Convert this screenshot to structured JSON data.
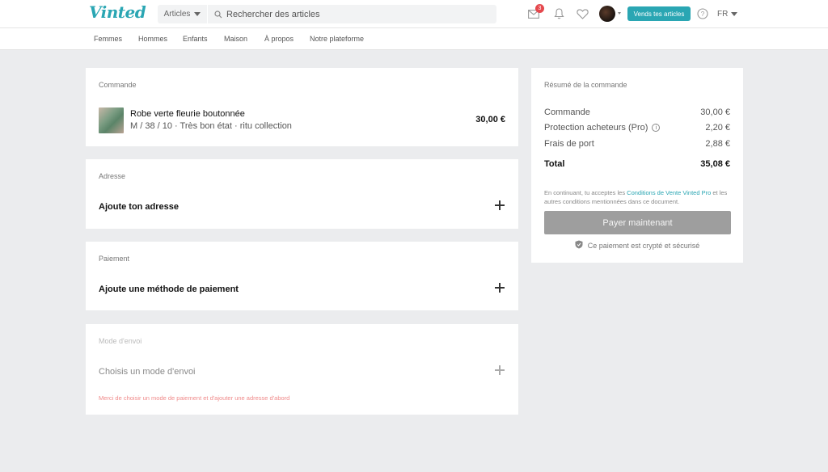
{
  "header": {
    "logo": "Vinted",
    "search_category": "Articles",
    "search_placeholder": "Rechercher des articles",
    "inbox_count": "3",
    "sell_label": "Vends tes articles",
    "language": "FR"
  },
  "nav": [
    "Femmes",
    "Hommes",
    "Enfants",
    "Maison",
    "À propos",
    "Notre plateforme"
  ],
  "order": {
    "title": "Commande",
    "item_name": "Robe verte fleurie boutonnée",
    "item_details": "M / 38 / 10 · Très bon état · ritu collection",
    "item_price": "30,00 €"
  },
  "address": {
    "title": "Adresse",
    "action": "Ajoute ton adresse"
  },
  "payment": {
    "title": "Paiement",
    "action": "Ajoute une méthode de paiement"
  },
  "shipping": {
    "title": "Mode d'envoi",
    "action": "Choisis un mode d'envoi",
    "error": "Merci de choisir un mode de paiement et d'ajouter une adresse d'abord"
  },
  "summary": {
    "title": "Résumé de la commande",
    "rows": [
      {
        "label": "Commande",
        "value": "30,00 €"
      },
      {
        "label": "Protection acheteurs (Pro)",
        "value": "2,20 €"
      },
      {
        "label": "Frais de port",
        "value": "2,88 €"
      }
    ],
    "total_label": "Total",
    "total_value": "35,08 €",
    "legal_prefix": "En continuant, tu acceptes les ",
    "legal_link": "Conditions de Vente Vinted Pro",
    "legal_suffix": " et les autres conditions mentionnées dans ce document.",
    "pay_label": "Payer maintenant",
    "secure_text": "Ce paiement est crypté et sécurisé"
  },
  "colors": {
    "brand": "#2aa6b3",
    "background": "#ebecee",
    "badge": "#e5484d",
    "error": "#f08a8a",
    "pay_button": "#9e9e9e"
  }
}
